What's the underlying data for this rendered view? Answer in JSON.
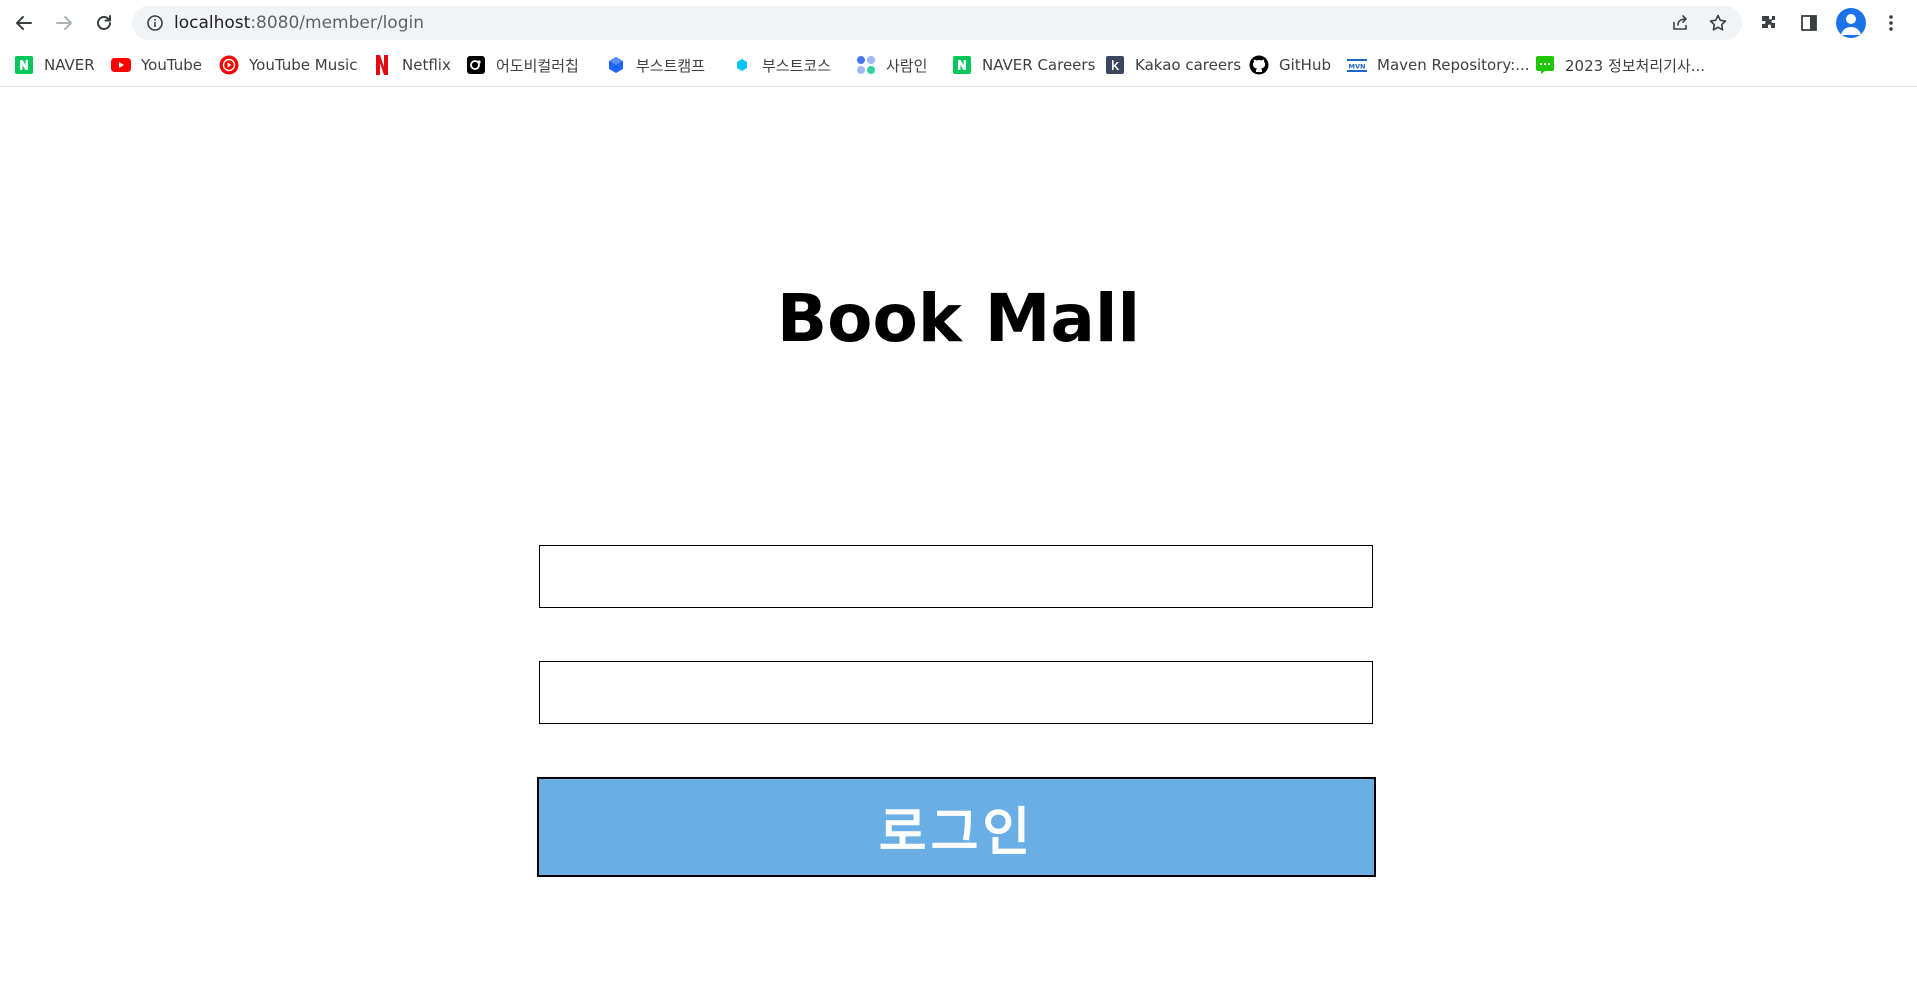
{
  "browser": {
    "url_host": "localhost",
    "url_path": ":8080/member/login"
  },
  "bookmarks": [
    {
      "label": "NAVER",
      "icon": "naver-icon",
      "color": "#03c75a"
    },
    {
      "label": "YouTube",
      "icon": "youtube-icon",
      "color": "#ff0000"
    },
    {
      "label": "YouTube Music",
      "icon": "youtube-music-icon",
      "color": "#ff0000"
    },
    {
      "label": "Netflix",
      "icon": "netflix-icon",
      "color": "#e50914"
    },
    {
      "label": "어도비컬러칩",
      "icon": "adobe-color-icon",
      "color": "#000000"
    },
    {
      "label": "부스트캠프",
      "icon": "boostcamp-icon",
      "color": "#1e64ff"
    },
    {
      "label": "부스트코스",
      "icon": "boostcourse-icon",
      "color": "#00c4ff"
    },
    {
      "label": "사람인",
      "icon": "saramin-icon",
      "color": "#4876ef"
    },
    {
      "label": "NAVER Careers",
      "icon": "naver-careers-icon",
      "color": "#03c75a"
    },
    {
      "label": "Kakao careers",
      "icon": "kakao-careers-icon",
      "color": "#3c4560"
    },
    {
      "label": "GitHub",
      "icon": "github-icon",
      "color": "#000000"
    },
    {
      "label": "Maven Repository:...",
      "icon": "mvn-icon",
      "color": "#1a66c9"
    },
    {
      "label": "2023 정보처리기사...",
      "icon": "chat-icon",
      "color": "#1ec800"
    }
  ],
  "page": {
    "title": "Book Mall",
    "username_value": "",
    "password_value": "",
    "login_label": "로그인",
    "login_button_color": "#6aaee6"
  }
}
